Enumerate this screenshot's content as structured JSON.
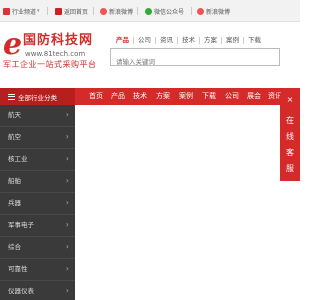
{
  "topbar": {
    "industry_channel": "行业频道",
    "home": "返回首页",
    "weibo": "新浪微博",
    "wechat": "微信公众号",
    "weibo2": "新浪微博"
  },
  "logo": {
    "title": "国防科技网",
    "url": "www.81tech.com",
    "slogan": "军工企业一站式采购平台"
  },
  "search": {
    "categories": [
      "产品",
      "公司",
      "资讯",
      "技术",
      "方案",
      "案例",
      "下载"
    ],
    "active_index": 0,
    "placeholder": "请输入关键词"
  },
  "nav": {
    "all_categories": "全部行业分类",
    "links": [
      "首页",
      "产品",
      "技术",
      "方案",
      "案例",
      "下载",
      "公司",
      "展会",
      "资讯"
    ]
  },
  "sidebar": {
    "items": [
      "航天",
      "航空",
      "核工业",
      "船舶",
      "兵器",
      "军事电子",
      "综合",
      "可靠性",
      "仪器仪表"
    ]
  },
  "service": {
    "close": "×",
    "chars": [
      "在",
      "线",
      "客",
      "服"
    ]
  },
  "colors": {
    "brand_red": "#d42a2a",
    "sidebar_bg": "#3a3a3a"
  }
}
